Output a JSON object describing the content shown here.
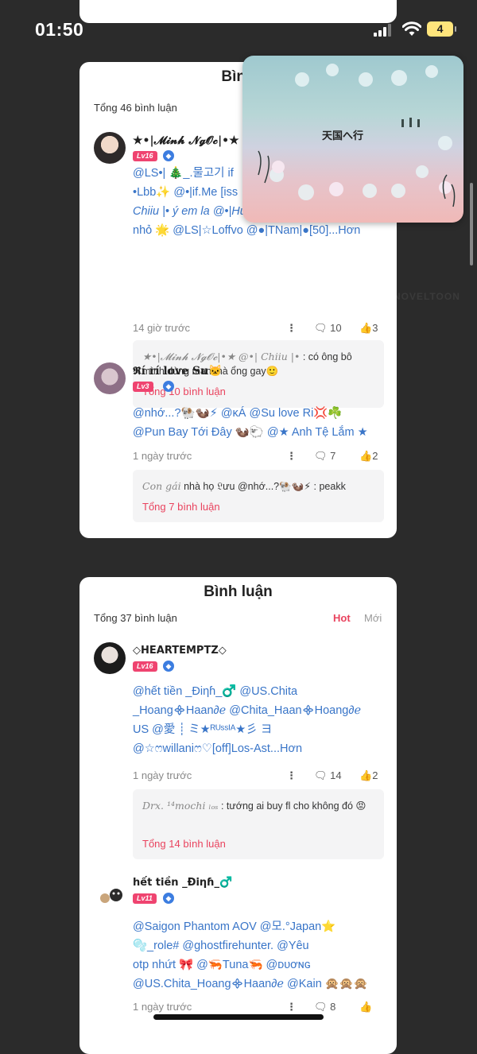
{
  "status": {
    "time": "01:50",
    "battery": "4"
  },
  "watermark": "NOVELTOON",
  "overlay": {
    "title": "天国へ行"
  },
  "card1": {
    "title": "Bình",
    "count": "Tổng 46 bình luận",
    "comments": [
      {
        "username": "★•|𝓜𝓲𝓷𝓱 𝓝𝓰𝓞𝓬|•★",
        "level": "Lv16",
        "lines": [
          "@LS•| 🎄_.물고기 if",
          "•Lbb✨ @•|if.Me [iss",
          "Chiiu |• ý em la @•|Hưng",
          "nhỏ 🌟 @LS|☆Loffvo @●|TNam|●[50]...Hơn"
        ],
        "time": "14 giờ trước",
        "comments": "10",
        "likes": "3",
        "reply_name": "★•|𝓜𝓲𝓷𝓱 𝓝𝓰𝓞𝓬|•★ @•| Chiiu |•",
        "reply_text": ": có ông bô mình dùng man mà ổng gay🙂",
        "reply_more": "Tổng 10 bình luận"
      },
      {
        "username": "𝕽í rí love Su🐱",
        "level": "Lv3",
        "lines": [
          "@nhớ...?🐏🦦⚡ @ĸÁ @Su love Ri💢☘️",
          "@Pun Bay Tới Đây 🦦🐑 @★ Anh Tệ Lắm ★"
        ],
        "time": "1 ngày trước",
        "comments": "7",
        "likes": "2",
        "reply_name": "Con gái",
        "reply_text": "nhà họ 𝔏ưu @nhớ...?🐏🦦⚡ : peakk",
        "reply_more": "Tổng 7 bình luận"
      }
    ]
  },
  "card2": {
    "title": "Bình luận",
    "count": "Tổng 37 bình luận",
    "sort_hot": "Hot",
    "sort_new": "Mới",
    "comments": [
      {
        "username": "◇HEARTEMPTZ◇",
        "level": "Lv16",
        "lines": [
          "@hết tiền _Điηɦ_♂️ @US.Chita",
          "_Hoang᯽Haan∂ℯ @Chita_Haan᯽Hoang∂ℯ",
          "US @愛 ┊ ミ★ᴿᵁˢˢᴵᴬ★彡 ヨ",
          "@☆ෆwillaniෆ♡[off]Los-Ast...Hơn"
        ],
        "time": "1 ngày trước",
        "comments": "14",
        "likes": "2",
        "reply_name": "Drx. ¹⁴mochi ₗₒₛ",
        "reply_text": ": tướng ai buy fl cho không đó 😡",
        "reply_more": "Tổng 14 bình luận"
      },
      {
        "username": "hết tiền _Điηɦ_♂️",
        "level": "Lv11",
        "lines": [
          "@Saigon Phantom AOV @모.°Japan⭐",
          "🫧_role# @ghostfirehunter. @Yêu",
          "otp nhứt 🎀 @🦐Tuna🦐 @ᴅᴜơɴɢ",
          "@US.Chita_Hoang᯽Haan∂ℯ @Kain 🙊🙊🙊"
        ],
        "time": "1 ngày trước",
        "comments": "8",
        "likes": ""
      }
    ]
  }
}
